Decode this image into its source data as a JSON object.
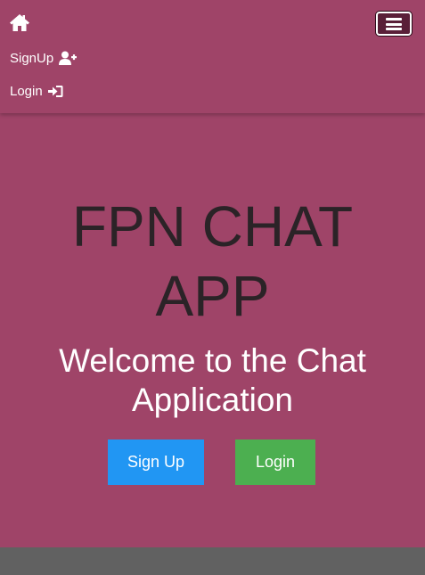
{
  "nav": {
    "home_icon": "home-icon",
    "signup_label": "SignUp",
    "signup_icon": "user-plus-icon",
    "login_label": "Login",
    "login_icon": "sign-in-icon",
    "menu_icon": "hamburger-icon"
  },
  "hero": {
    "title_line1": "FPN CHAT",
    "title_line2": "APP",
    "subtitle_line1": "Welcome to the Chat",
    "subtitle_line2": "Application",
    "signup_button": "Sign Up",
    "login_button": "Login"
  },
  "colors": {
    "nav_background": "#9f4468",
    "hero_background": "#9f4468",
    "footer_background": "#616161",
    "signup_button": "#2196f3",
    "login_button": "#4caf50",
    "title_text": "#2b2327"
  }
}
